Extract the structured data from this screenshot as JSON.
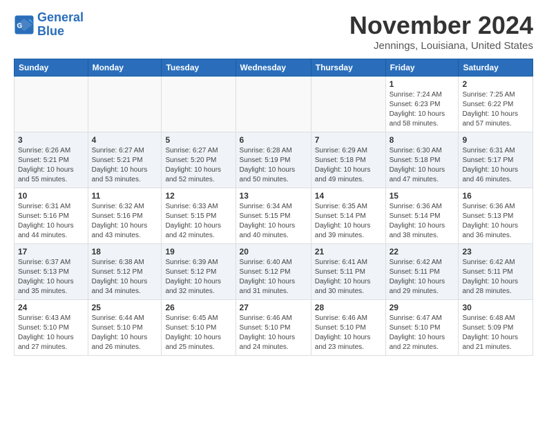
{
  "header": {
    "logo_line1": "General",
    "logo_line2": "Blue",
    "month": "November 2024",
    "location": "Jennings, Louisiana, United States"
  },
  "weekdays": [
    "Sunday",
    "Monday",
    "Tuesday",
    "Wednesday",
    "Thursday",
    "Friday",
    "Saturday"
  ],
  "weeks": [
    [
      {
        "day": "",
        "info": ""
      },
      {
        "day": "",
        "info": ""
      },
      {
        "day": "",
        "info": ""
      },
      {
        "day": "",
        "info": ""
      },
      {
        "day": "",
        "info": ""
      },
      {
        "day": "1",
        "info": "Sunrise: 7:24 AM\nSunset: 6:23 PM\nDaylight: 10 hours\nand 58 minutes."
      },
      {
        "day": "2",
        "info": "Sunrise: 7:25 AM\nSunset: 6:22 PM\nDaylight: 10 hours\nand 57 minutes."
      }
    ],
    [
      {
        "day": "3",
        "info": "Sunrise: 6:26 AM\nSunset: 5:21 PM\nDaylight: 10 hours\nand 55 minutes."
      },
      {
        "day": "4",
        "info": "Sunrise: 6:27 AM\nSunset: 5:21 PM\nDaylight: 10 hours\nand 53 minutes."
      },
      {
        "day": "5",
        "info": "Sunrise: 6:27 AM\nSunset: 5:20 PM\nDaylight: 10 hours\nand 52 minutes."
      },
      {
        "day": "6",
        "info": "Sunrise: 6:28 AM\nSunset: 5:19 PM\nDaylight: 10 hours\nand 50 minutes."
      },
      {
        "day": "7",
        "info": "Sunrise: 6:29 AM\nSunset: 5:18 PM\nDaylight: 10 hours\nand 49 minutes."
      },
      {
        "day": "8",
        "info": "Sunrise: 6:30 AM\nSunset: 5:18 PM\nDaylight: 10 hours\nand 47 minutes."
      },
      {
        "day": "9",
        "info": "Sunrise: 6:31 AM\nSunset: 5:17 PM\nDaylight: 10 hours\nand 46 minutes."
      }
    ],
    [
      {
        "day": "10",
        "info": "Sunrise: 6:31 AM\nSunset: 5:16 PM\nDaylight: 10 hours\nand 44 minutes."
      },
      {
        "day": "11",
        "info": "Sunrise: 6:32 AM\nSunset: 5:16 PM\nDaylight: 10 hours\nand 43 minutes."
      },
      {
        "day": "12",
        "info": "Sunrise: 6:33 AM\nSunset: 5:15 PM\nDaylight: 10 hours\nand 42 minutes."
      },
      {
        "day": "13",
        "info": "Sunrise: 6:34 AM\nSunset: 5:15 PM\nDaylight: 10 hours\nand 40 minutes."
      },
      {
        "day": "14",
        "info": "Sunrise: 6:35 AM\nSunset: 5:14 PM\nDaylight: 10 hours\nand 39 minutes."
      },
      {
        "day": "15",
        "info": "Sunrise: 6:36 AM\nSunset: 5:14 PM\nDaylight: 10 hours\nand 38 minutes."
      },
      {
        "day": "16",
        "info": "Sunrise: 6:36 AM\nSunset: 5:13 PM\nDaylight: 10 hours\nand 36 minutes."
      }
    ],
    [
      {
        "day": "17",
        "info": "Sunrise: 6:37 AM\nSunset: 5:13 PM\nDaylight: 10 hours\nand 35 minutes."
      },
      {
        "day": "18",
        "info": "Sunrise: 6:38 AM\nSunset: 5:12 PM\nDaylight: 10 hours\nand 34 minutes."
      },
      {
        "day": "19",
        "info": "Sunrise: 6:39 AM\nSunset: 5:12 PM\nDaylight: 10 hours\nand 32 minutes."
      },
      {
        "day": "20",
        "info": "Sunrise: 6:40 AM\nSunset: 5:12 PM\nDaylight: 10 hours\nand 31 minutes."
      },
      {
        "day": "21",
        "info": "Sunrise: 6:41 AM\nSunset: 5:11 PM\nDaylight: 10 hours\nand 30 minutes."
      },
      {
        "day": "22",
        "info": "Sunrise: 6:42 AM\nSunset: 5:11 PM\nDaylight: 10 hours\nand 29 minutes."
      },
      {
        "day": "23",
        "info": "Sunrise: 6:42 AM\nSunset: 5:11 PM\nDaylight: 10 hours\nand 28 minutes."
      }
    ],
    [
      {
        "day": "24",
        "info": "Sunrise: 6:43 AM\nSunset: 5:10 PM\nDaylight: 10 hours\nand 27 minutes."
      },
      {
        "day": "25",
        "info": "Sunrise: 6:44 AM\nSunset: 5:10 PM\nDaylight: 10 hours\nand 26 minutes."
      },
      {
        "day": "26",
        "info": "Sunrise: 6:45 AM\nSunset: 5:10 PM\nDaylight: 10 hours\nand 25 minutes."
      },
      {
        "day": "27",
        "info": "Sunrise: 6:46 AM\nSunset: 5:10 PM\nDaylight: 10 hours\nand 24 minutes."
      },
      {
        "day": "28",
        "info": "Sunrise: 6:46 AM\nSunset: 5:10 PM\nDaylight: 10 hours\nand 23 minutes."
      },
      {
        "day": "29",
        "info": "Sunrise: 6:47 AM\nSunset: 5:10 PM\nDaylight: 10 hours\nand 22 minutes."
      },
      {
        "day": "30",
        "info": "Sunrise: 6:48 AM\nSunset: 5:09 PM\nDaylight: 10 hours\nand 21 minutes."
      }
    ]
  ]
}
